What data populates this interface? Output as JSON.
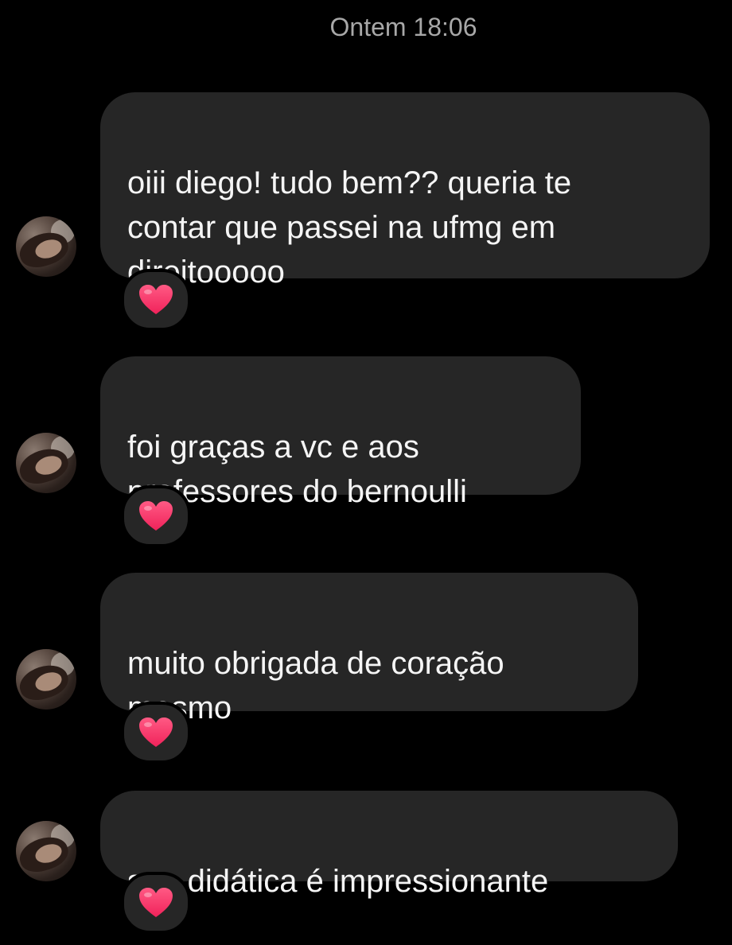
{
  "timestamp": "Ontem 18:06",
  "messages": [
    {
      "text": "oiii diego! tudo bem?? queria te\ncontar que passei na ufmg em\ndireitooooo",
      "reaction": "heart-icon"
    },
    {
      "text": "foi graças a vc e aos\nprofessores do bernoulli",
      "reaction": "heart-icon"
    },
    {
      "text": "muito obrigada de coração\nmesmo",
      "reaction": "heart-icon"
    },
    {
      "text": "sua didática é impressionante",
      "reaction": "heart-icon"
    }
  ],
  "colors": {
    "background": "#000000",
    "bubble": "#262626",
    "text": "#f5f5f5",
    "timestamp": "#a8a8a8",
    "heart": "#ff3b6b"
  }
}
